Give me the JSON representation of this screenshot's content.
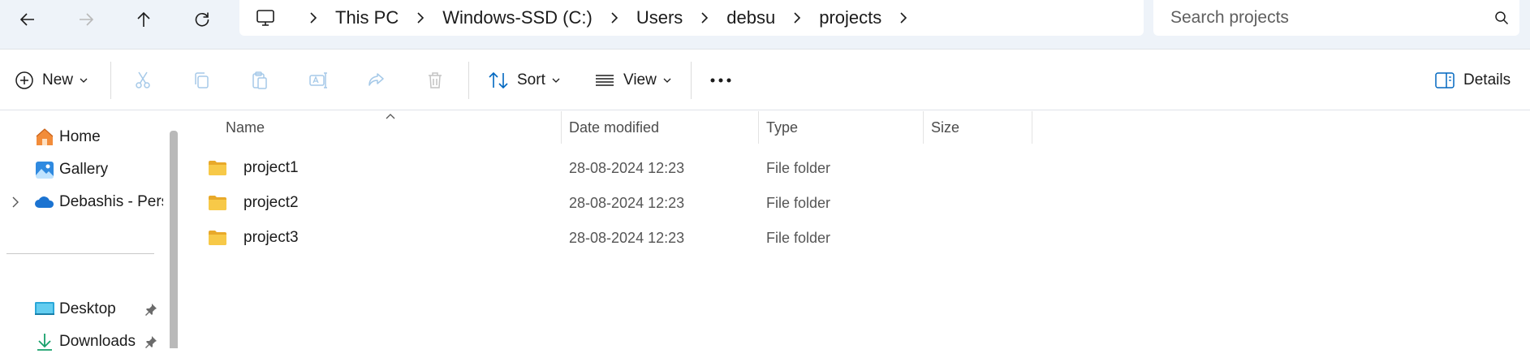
{
  "nav": {
    "back_icon": "arrow-left-icon",
    "forward_icon": "arrow-right-icon",
    "up_icon": "arrow-up-icon",
    "refresh_icon": "refresh-icon"
  },
  "breadcrumb": {
    "root_icon": "monitor-icon",
    "items": [
      "This PC",
      "Windows-SSD (C:)",
      "Users",
      "debsu",
      "projects"
    ]
  },
  "search": {
    "placeholder": "Search projects"
  },
  "toolbar": {
    "new_label": "New",
    "sort_label": "Sort",
    "view_label": "View",
    "details_label": "Details"
  },
  "sidebar": {
    "items": [
      {
        "label": "Home",
        "icon": "home-icon"
      },
      {
        "label": "Gallery",
        "icon": "gallery-icon"
      },
      {
        "label": "Debashis - Personal",
        "icon": "onedrive-cloud-icon"
      },
      {
        "label": "Desktop",
        "icon": "desktop-icon",
        "pinned": true
      },
      {
        "label": "Downloads",
        "icon": "download-icon",
        "pinned": true
      }
    ]
  },
  "columns": {
    "name": "Name",
    "date": "Date modified",
    "type": "Type",
    "size": "Size"
  },
  "files": [
    {
      "name": "project1",
      "date": "28-08-2024 12:23",
      "type": "File folder"
    },
    {
      "name": "project2",
      "date": "28-08-2024 12:23",
      "type": "File folder"
    },
    {
      "name": "project3",
      "date": "28-08-2024 12:23",
      "type": "File folder"
    }
  ],
  "colors": {
    "folder": "#f7c948",
    "accent": "#0067c0",
    "chrome": "#eef3f9"
  }
}
